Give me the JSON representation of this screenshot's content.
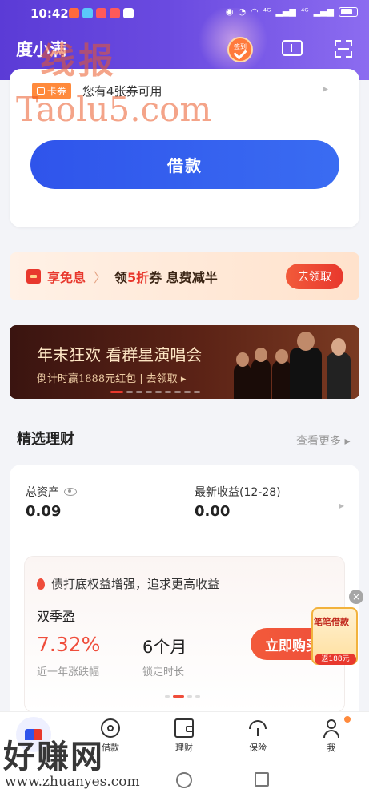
{
  "statusbar": {
    "time": "10:42",
    "signal": "⁴ᴳ",
    "signal2": "⁴ᴳ"
  },
  "header": {
    "app_title": "度小满",
    "checkin_label": "签到",
    "ticket_icon": "ticket-icon",
    "scan_icon": "scan-icon"
  },
  "loan": {
    "coupon_tag": "卡券",
    "coupon_text": "您有4张券可用",
    "borrow_button": "借款"
  },
  "promo": {
    "title": "享免息",
    "text_prefix": "领",
    "text_highlight": "5折",
    "text_suffix": "券 息费减半",
    "button": "去领取"
  },
  "concert": {
    "title": "年末狂欢 看群星演唱会",
    "subtitle": "倒计时赢1888元红包 | 去领取 ▸"
  },
  "finance": {
    "section_title": "精选理财",
    "more": "查看更多 ▸",
    "total_assets_label": "总资产",
    "total_assets_value": "0.09",
    "latest_income_label": "最新收益(12-28)",
    "latest_income_value": "0.00",
    "product_banner": "债打底权益增强，追求更高收益",
    "product_name": "双季盈",
    "product_rate": "7.32%",
    "product_rate_label": "近一年涨跌幅",
    "product_term": "6个月",
    "product_term_label": "锁定时长",
    "buy_button": "立即购买"
  },
  "float_ad": {
    "title": "笔笔借款",
    "amount": "返188元"
  },
  "nav": {
    "items": [
      {
        "label": "借款"
      },
      {
        "label": "理财"
      },
      {
        "label": "保险"
      },
      {
        "label": "我"
      }
    ]
  },
  "watermarks": {
    "top": "线报",
    "taolu": "Taolu5.com",
    "bottom": "好赚网",
    "url": "www.zhuanyes.com"
  },
  "colors": {
    "accent_blue": "#2f54eb",
    "accent_red": "#e8382d",
    "header_purple": "#5b3bd6"
  }
}
